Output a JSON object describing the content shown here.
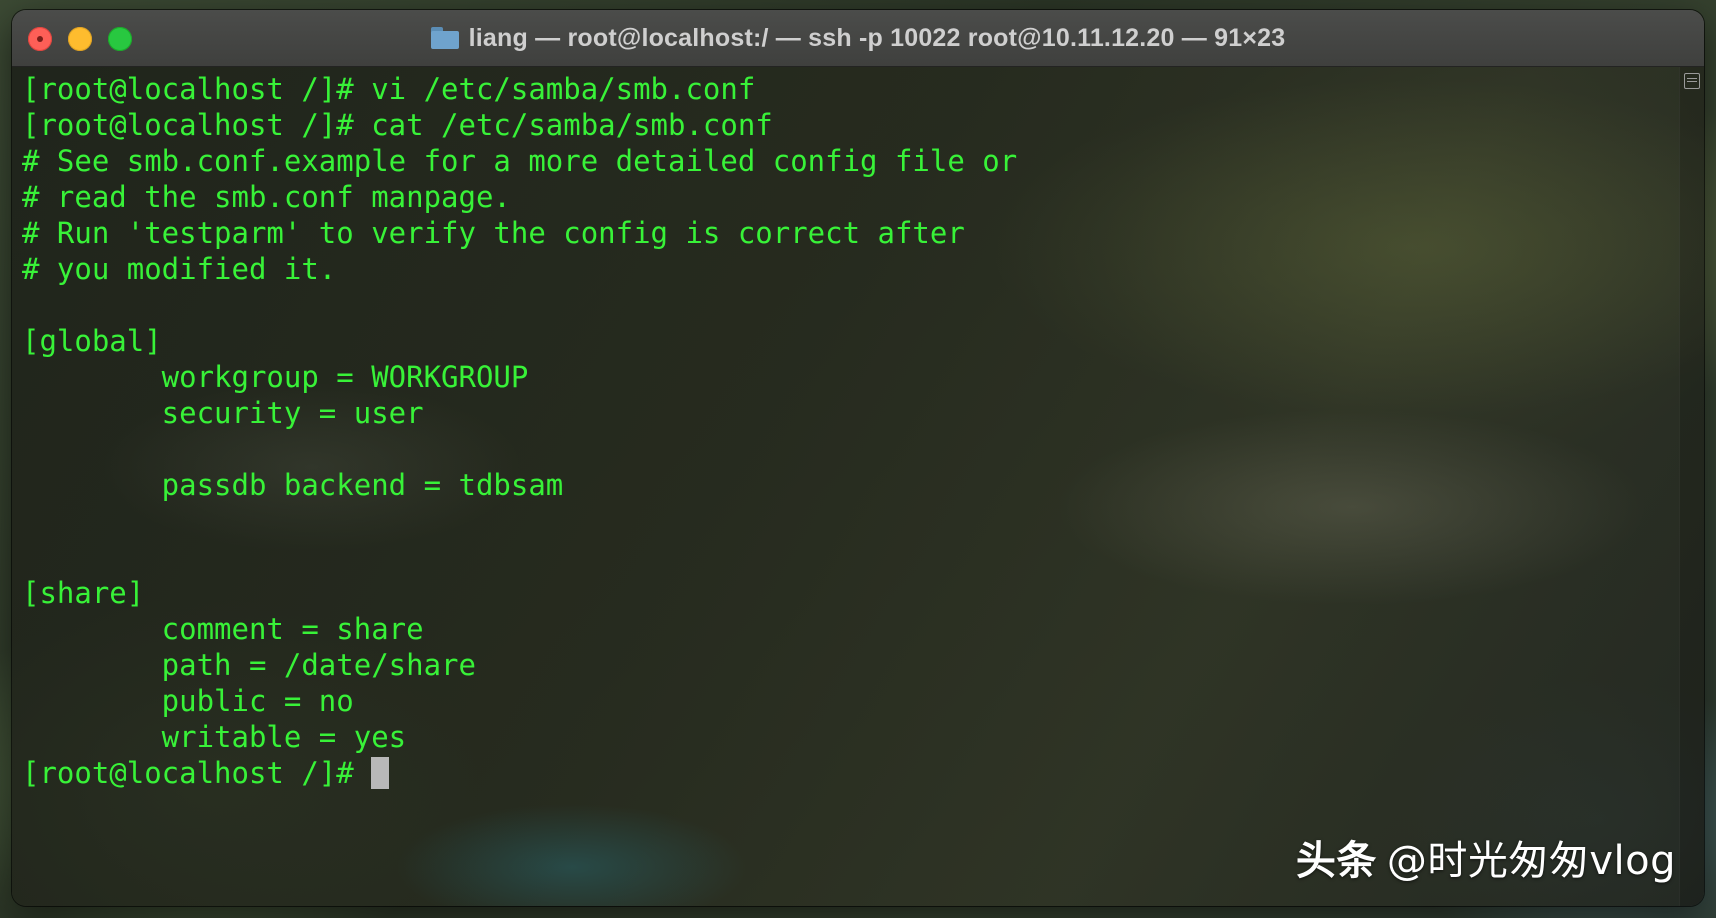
{
  "window": {
    "title": "liang — root@localhost:/ — ssh -p 10022 root@10.11.12.20 — 91×23"
  },
  "terminal": {
    "lines": [
      "[root@localhost /]# vi /etc/samba/smb.conf",
      "[root@localhost /]# cat /etc/samba/smb.conf",
      "# See smb.conf.example for a more detailed config file or",
      "# read the smb.conf manpage.",
      "# Run 'testparm' to verify the config is correct after",
      "# you modified it.",
      "",
      "[global]",
      "        workgroup = WORKGROUP",
      "        security = user",
      "",
      "        passdb backend = tdbsam",
      "",
      "",
      "[share]",
      "        comment = share",
      "        path = /date/share",
      "        public = no",
      "        writable = yes",
      "[root@localhost /]# "
    ],
    "text_color": "#38f238"
  },
  "watermark": {
    "brand": "头条",
    "handle": "@时光匆匆vlog"
  },
  "colors": {
    "close": "#fe5f57",
    "minimize": "#febc2e",
    "maximize": "#28c840"
  }
}
